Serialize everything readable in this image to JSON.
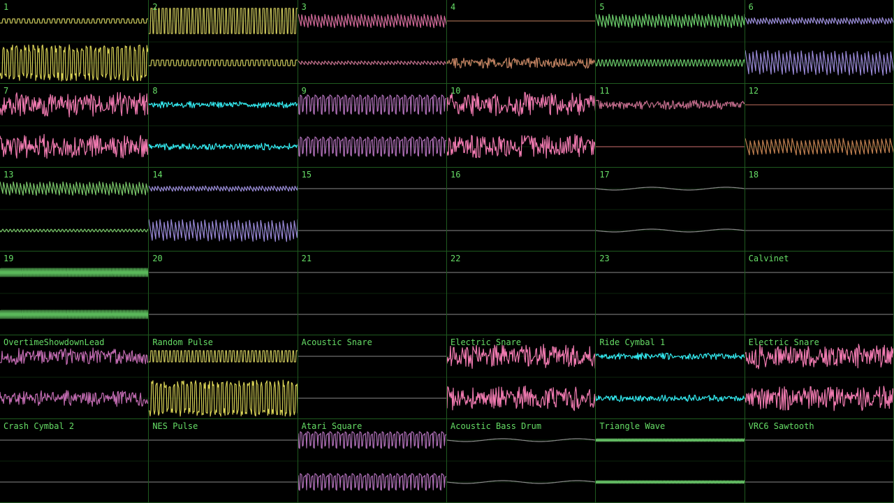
{
  "grid": {
    "cols": 6,
    "rows": 6
  },
  "colors": {
    "background": "#000000",
    "gridline": "#1f5a1f",
    "label": "#66dd66",
    "flat": "#8a8a8a"
  },
  "channels": [
    {
      "label": "1",
      "top": {
        "color": "#c9c45a",
        "shape": "square",
        "amp": 3,
        "freq": 30
      },
      "bottom": {
        "color": "#d6d055",
        "shape": "square",
        "amp": 20,
        "freq": 34,
        "noise": 0.3
      }
    },
    {
      "label": "2",
      "top": {
        "color": "#c9c45a",
        "shape": "square",
        "amp": 18,
        "freq": 40
      },
      "bottom": {
        "color": "#c9c45a",
        "shape": "square",
        "amp": 4,
        "freq": 30
      }
    },
    {
      "label": "3",
      "top": {
        "color": "#d26a9a",
        "shape": "saw",
        "amp": 10,
        "freq": 45
      },
      "bottom": {
        "color": "#c06a8a",
        "shape": "saw",
        "amp": 3,
        "freq": 45
      }
    },
    {
      "label": "4",
      "top": {
        "color": "#c08060",
        "shape": "flat",
        "amp": 1,
        "freq": 40
      },
      "bottom": {
        "color": "#c08060",
        "shape": "noise",
        "amp": 8,
        "freq": 60
      }
    },
    {
      "label": "5",
      "top": {
        "color": "#6ccc6c",
        "shape": "saw",
        "amp": 10,
        "freq": 45
      },
      "bottom": {
        "color": "#6ccc6c",
        "shape": "sine",
        "amp": 5,
        "freq": 40
      }
    },
    {
      "label": "6",
      "top": {
        "color": "#9a8ad8",
        "shape": "saw",
        "amp": 5,
        "freq": 50
      },
      "bottom": {
        "color": "#9a8ad8",
        "shape": "saw",
        "amp": 18,
        "freq": 40
      }
    },
    {
      "label": "7",
      "top": {
        "color": "#f07ab0",
        "shape": "noise",
        "amp": 18,
        "freq": 80
      },
      "bottom": {
        "color": "#f07ab0",
        "shape": "noise",
        "amp": 18,
        "freq": 80
      }
    },
    {
      "label": "8",
      "top": {
        "color": "#33e8f0",
        "shape": "noise",
        "amp": 5,
        "freq": 90
      },
      "bottom": {
        "color": "#33e8f0",
        "shape": "noise",
        "amp": 5,
        "freq": 90
      }
    },
    {
      "label": "9",
      "top": {
        "color": "#b070b8",
        "shape": "pulse",
        "amp": 14,
        "freq": 40
      },
      "bottom": {
        "color": "#b070b8",
        "shape": "pulse",
        "amp": 14,
        "freq": 40
      }
    },
    {
      "label": "10",
      "top": {
        "color": "#f07ab0",
        "shape": "noise",
        "amp": 18,
        "freq": 80
      },
      "bottom": {
        "color": "#f07ab0",
        "shape": "noise",
        "amp": 18,
        "freq": 80
      }
    },
    {
      "label": "11",
      "top": {
        "color": "#c06a8a",
        "shape": "noise",
        "amp": 7,
        "freq": 70
      },
      "bottom": {
        "color": "#d07070",
        "shape": "flat",
        "amp": 1,
        "freq": 40
      }
    },
    {
      "label": "12",
      "top": {
        "color": "#c07060",
        "shape": "flat",
        "amp": 1,
        "freq": 40
      },
      "bottom": {
        "color": "#c08050",
        "shape": "saw",
        "amp": 12,
        "freq": 35
      }
    },
    {
      "label": "13",
      "top": {
        "color": "#7ac66a",
        "shape": "saw",
        "amp": 10,
        "freq": 45
      },
      "bottom": {
        "color": "#7ac66a",
        "shape": "sine",
        "amp": 2,
        "freq": 40
      }
    },
    {
      "label": "14",
      "top": {
        "color": "#9a8ad8",
        "shape": "saw",
        "amp": 4,
        "freq": 50
      },
      "bottom": {
        "color": "#9a8ad8",
        "shape": "saw",
        "amp": 16,
        "freq": 40
      }
    },
    {
      "label": "15",
      "top": {
        "color": "#8a8a8a",
        "shape": "flat",
        "amp": 0,
        "freq": 1
      },
      "bottom": {
        "color": "#8a8a8a",
        "shape": "flat",
        "amp": 0,
        "freq": 1
      }
    },
    {
      "label": "16",
      "top": {
        "color": "#8a8a8a",
        "shape": "flat",
        "amp": 0,
        "freq": 1
      },
      "bottom": {
        "color": "#8a8a8a",
        "shape": "flat",
        "amp": 0,
        "freq": 1
      }
    },
    {
      "label": "17",
      "top": {
        "color": "#8a8a8a",
        "shape": "sine",
        "amp": 2,
        "freq": 2
      },
      "bottom": {
        "color": "#8a8a8a",
        "shape": "sine",
        "amp": 2,
        "freq": 2
      }
    },
    {
      "label": "18",
      "top": {
        "color": "#8a8a8a",
        "shape": "flat",
        "amp": 0,
        "freq": 1
      },
      "bottom": {
        "color": "#8a8a8a",
        "shape": "flat",
        "amp": 0,
        "freq": 1
      }
    },
    {
      "label": "19",
      "top": {
        "color": "#5ab85a",
        "shape": "dense",
        "amp": 6,
        "freq": 200
      },
      "bottom": {
        "color": "#5ab85a",
        "shape": "dense",
        "amp": 6,
        "freq": 200
      }
    },
    {
      "label": "20",
      "top": {
        "color": "#8a8a8a",
        "shape": "flat",
        "amp": 0,
        "freq": 1
      },
      "bottom": {
        "color": "#8a8a8a",
        "shape": "flat",
        "amp": 0,
        "freq": 1
      }
    },
    {
      "label": "21",
      "top": {
        "color": "#8a8a8a",
        "shape": "flat",
        "amp": 0,
        "freq": 1
      },
      "bottom": {
        "color": "#8a8a8a",
        "shape": "flat",
        "amp": 0,
        "freq": 1
      }
    },
    {
      "label": "22",
      "top": {
        "color": "#8a8a8a",
        "shape": "flat",
        "amp": 0,
        "freq": 1
      },
      "bottom": {
        "color": "#8a8a8a",
        "shape": "flat",
        "amp": 0,
        "freq": 1
      }
    },
    {
      "label": "23",
      "top": {
        "color": "#8a8a8a",
        "shape": "flat",
        "amp": 0,
        "freq": 1
      },
      "bottom": {
        "color": "#8a8a8a",
        "shape": "flat",
        "amp": 0,
        "freq": 1
      }
    },
    {
      "label": "Calvinet",
      "top": {
        "color": "#8a8a8a",
        "shape": "flat",
        "amp": 0,
        "freq": 1
      },
      "bottom": {
        "color": "#8a8a8a",
        "shape": "flat",
        "amp": 0,
        "freq": 1
      }
    },
    {
      "label": "OvertimeShowdownLead",
      "top": {
        "color": "#c06ab0",
        "shape": "noise",
        "amp": 12,
        "freq": 70
      },
      "bottom": {
        "color": "#c06ab0",
        "shape": "noise",
        "amp": 12,
        "freq": 70
      }
    },
    {
      "label": "Random Pulse",
      "top": {
        "color": "#c9c45a",
        "shape": "square",
        "amp": 8,
        "freq": 40
      },
      "bottom": {
        "color": "#d6d055",
        "shape": "square",
        "amp": 20,
        "freq": 34,
        "noise": 0.3
      }
    },
    {
      "label": "Acoustic Snare",
      "top": {
        "color": "#8a8a8a",
        "shape": "flat",
        "amp": 0,
        "freq": 1
      },
      "bottom": {
        "color": "#8a8a8a",
        "shape": "flat",
        "amp": 0,
        "freq": 1
      }
    },
    {
      "label": "Electric Snare",
      "top": {
        "color": "#f07ab0",
        "shape": "noise",
        "amp": 18,
        "freq": 80
      },
      "bottom": {
        "color": "#f07ab0",
        "shape": "noise",
        "amp": 18,
        "freq": 80
      }
    },
    {
      "label": "Ride Cymbal 1",
      "top": {
        "color": "#33e8f0",
        "shape": "noise",
        "amp": 5,
        "freq": 90
      },
      "bottom": {
        "color": "#33e8f0",
        "shape": "noise",
        "amp": 5,
        "freq": 90
      }
    },
    {
      "label": "Electric Snare",
      "top": {
        "color": "#f07ab0",
        "shape": "noise",
        "amp": 18,
        "freq": 80
      },
      "bottom": {
        "color": "#f07ab0",
        "shape": "noise",
        "amp": 18,
        "freq": 80
      }
    },
    {
      "label": "Crash Cymbal 2",
      "top": {
        "color": "#8a8a8a",
        "shape": "flat",
        "amp": 0,
        "freq": 1
      },
      "bottom": {
        "color": "#8a8a8a",
        "shape": "flat",
        "amp": 0,
        "freq": 1
      }
    },
    {
      "label": "NES Pulse",
      "top": {
        "color": "#8a8a8a",
        "shape": "flat",
        "amp": 0,
        "freq": 1
      },
      "bottom": {
        "color": "#8a8a8a",
        "shape": "flat",
        "amp": 0,
        "freq": 1
      }
    },
    {
      "label": "Atari Square",
      "top": {
        "color": "#b070b8",
        "shape": "pulse",
        "amp": 12,
        "freq": 40
      },
      "bottom": {
        "color": "#b070b8",
        "shape": "pulse",
        "amp": 12,
        "freq": 40
      }
    },
    {
      "label": "Acoustic Bass Drum",
      "top": {
        "color": "#8a8a8a",
        "shape": "sine",
        "amp": 2,
        "freq": 2
      },
      "bottom": {
        "color": "#8a8a8a",
        "shape": "sine",
        "amp": 2,
        "freq": 2
      }
    },
    {
      "label": "Triangle Wave",
      "top": {
        "color": "#6ccc6c",
        "shape": "dense",
        "amp": 2,
        "freq": 200
      },
      "bottom": {
        "color": "#6ccc6c",
        "shape": "dense",
        "amp": 2,
        "freq": 200
      }
    },
    {
      "label": "VRC6 Sawtooth",
      "top": {
        "color": "#8a8a8a",
        "shape": "flat",
        "amp": 0,
        "freq": 1
      },
      "bottom": {
        "color": "#8a8a8a",
        "shape": "flat",
        "amp": 0,
        "freq": 1
      }
    }
  ]
}
